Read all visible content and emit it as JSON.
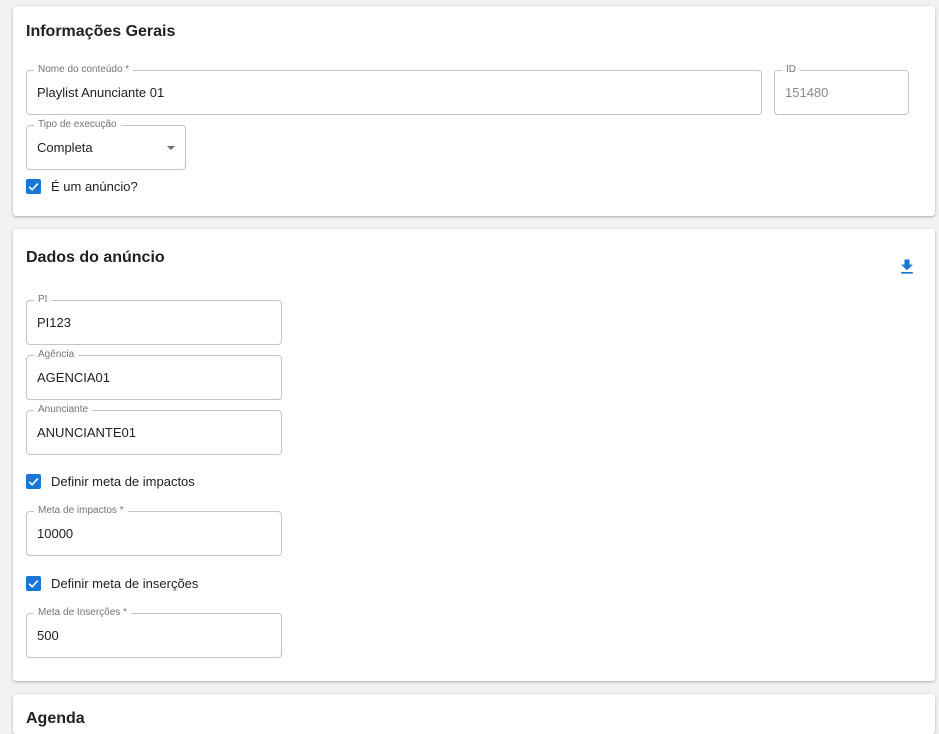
{
  "colors": {
    "accent": "#1976d2",
    "background": "#f2f2f2",
    "card": "#ffffff",
    "border": "#c4c4c4",
    "label": "#757575"
  },
  "general": {
    "title": "Informações Gerais",
    "name_label": "Nome do conteúdo *",
    "name_value": "Playlist Anunciante 01",
    "id_label": "ID",
    "id_value": "151480",
    "exec_label": "Tipo de execução",
    "exec_value": "Completa",
    "is_ad_label": "É um anúncio?",
    "is_ad_checked": true
  },
  "ad": {
    "title": "Dados do anúncio",
    "download_icon": "download-icon",
    "pi_label": "PI",
    "pi_value": "PI123",
    "agency_label": "Agência",
    "agency_value": "AGENCIA01",
    "advertiser_label": "Anunciante",
    "advertiser_value": "ANUNCIANTE01",
    "impacts_check_label": "Definir meta de impactos",
    "impacts_checked": true,
    "impacts_label": "Meta de impactos *",
    "impacts_value": "10000",
    "insertions_check_label": "Definir meta de inserções",
    "insertions_checked": true,
    "insertions_label": "Meta de Inserções *",
    "insertions_value": "500"
  },
  "schedule": {
    "title": "Agenda"
  }
}
